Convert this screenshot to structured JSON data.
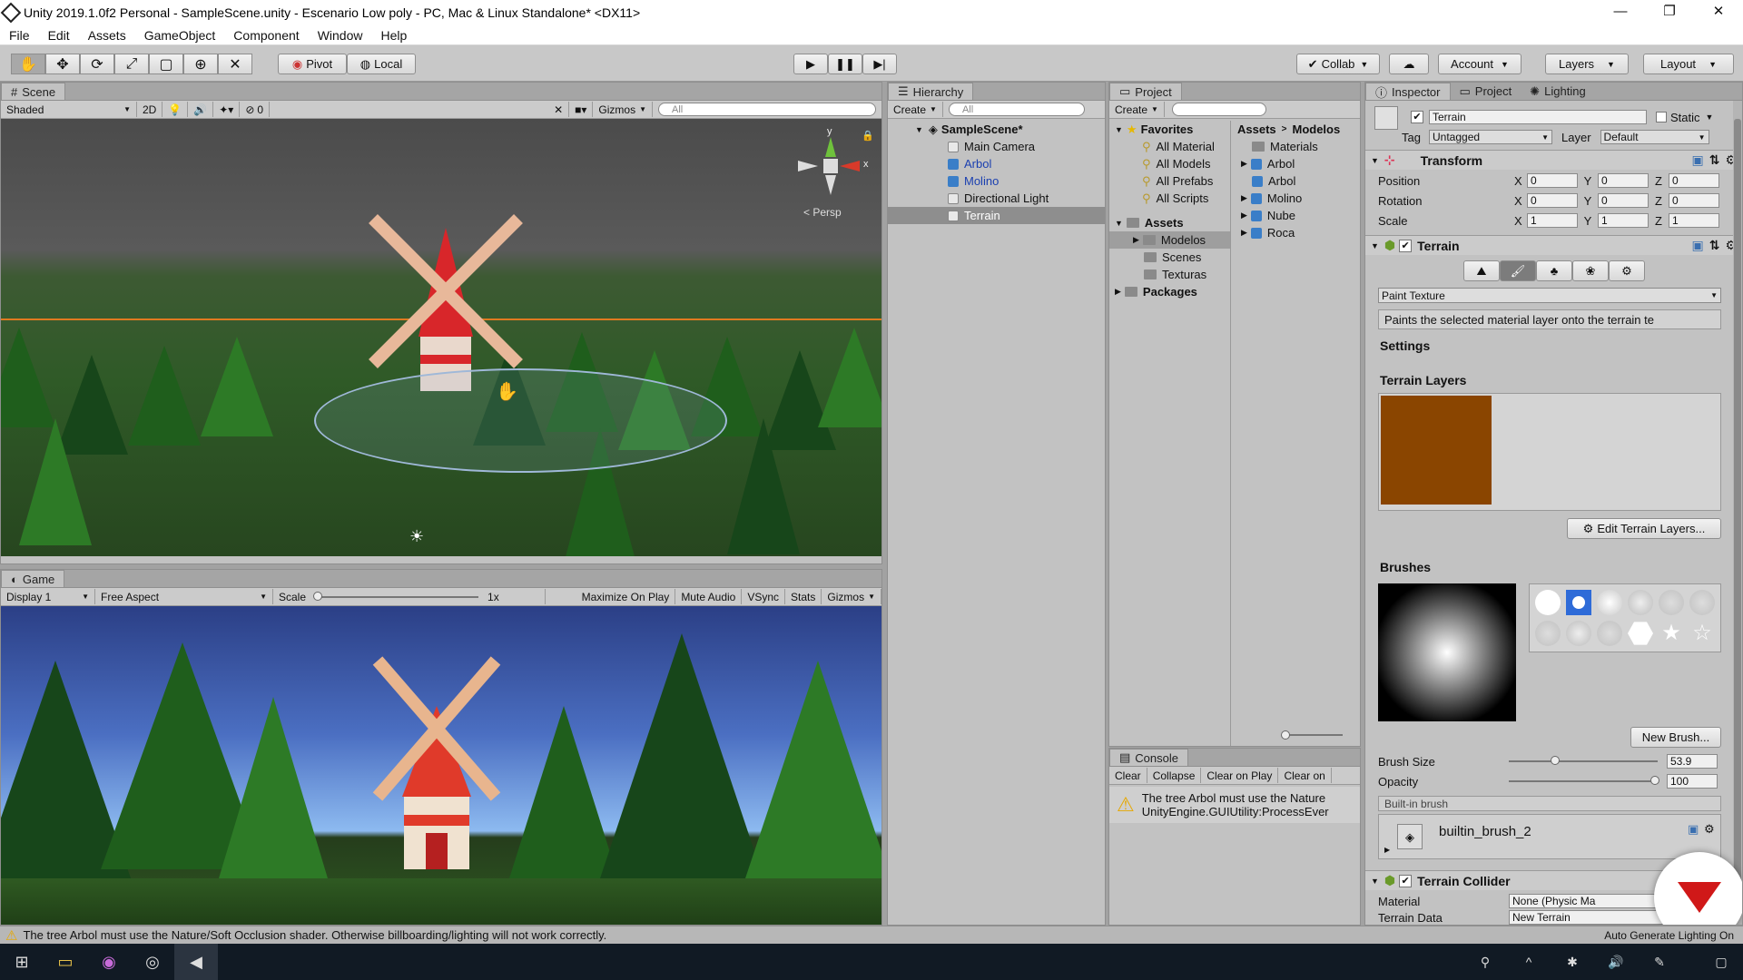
{
  "window": {
    "title": "Unity 2019.1.0f2 Personal - SampleScene.unity - Escenario Low poly - PC, Mac & Linux Standalone* <DX11>",
    "controls": [
      "—",
      "❐",
      "✕"
    ]
  },
  "menu": [
    "File",
    "Edit",
    "Assets",
    "GameObject",
    "Component",
    "Window",
    "Help"
  ],
  "toolbar": {
    "pivot_label": "Pivot",
    "local_label": "Local",
    "collab_label": "Collab",
    "account_label": "Account",
    "layers_label": "Layers",
    "layout_label": "Layout"
  },
  "scene": {
    "tab_label": "Scene",
    "shading": "Shaded",
    "mode_2d": "2D",
    "gizmos_label": "Gizmos",
    "search_placeholder": "All",
    "fx_count": "0",
    "persp_label": "Persp",
    "axis_y": "y",
    "axis_x": "x"
  },
  "game": {
    "tab_label": "Game",
    "display": "Display 1",
    "aspect": "Free Aspect",
    "scale_label": "Scale",
    "scale_value": "1x",
    "maximize_label": "Maximize On Play",
    "mute_label": "Mute Audio",
    "vsync_label": "VSync",
    "stats_label": "Stats",
    "gizmos_label": "Gizmos"
  },
  "hierarchy": {
    "tab_label": "Hierarchy",
    "create_label": "Create",
    "search_placeholder": "All",
    "scene_name": "SampleScene*",
    "items": [
      {
        "label": "Main Camera",
        "prefab": false
      },
      {
        "label": "Arbol",
        "prefab": true
      },
      {
        "label": "Molino",
        "prefab": true
      },
      {
        "label": "Directional Light",
        "prefab": false
      },
      {
        "label": "Terrain",
        "prefab": false
      }
    ]
  },
  "project": {
    "tab_label": "Project",
    "create_label": "Create",
    "favorites_label": "Favorites",
    "favorites": [
      "All Material",
      "All Models",
      "All Prefabs",
      "All Scripts"
    ],
    "assets_label": "Assets",
    "asset_folders": [
      "Modelos",
      "Scenes",
      "Texturas"
    ],
    "packages_label": "Packages",
    "breadcrumb_root": "Assets",
    "breadcrumb_current": "Modelos",
    "contents": [
      {
        "label": "Materials",
        "type": "folder"
      },
      {
        "label": "Arbol",
        "type": "model"
      },
      {
        "label": "Arbol",
        "type": "model"
      },
      {
        "label": "Molino",
        "type": "model"
      },
      {
        "label": "Nube",
        "type": "model"
      },
      {
        "label": "Roca",
        "type": "model"
      }
    ]
  },
  "console": {
    "tab_label": "Console",
    "buttons": [
      "Clear",
      "Collapse",
      "Clear on Play",
      "Clear on"
    ],
    "message_line1": "The tree Arbol must use the Nature",
    "message_line2": "UnityEngine.GUIUtility:ProcessEver"
  },
  "inspector": {
    "tabs": [
      "Inspector",
      "Project",
      "Lighting"
    ],
    "object_name": "Terrain",
    "static_label": "Static",
    "tag_label": "Tag",
    "tag_value": "Untagged",
    "layer_label": "Layer",
    "layer_value": "Default",
    "transform": {
      "title": "Transform",
      "rows": [
        {
          "label": "Position",
          "x": "0",
          "y": "0",
          "z": "0"
        },
        {
          "label": "Rotation",
          "x": "0",
          "y": "0",
          "z": "0"
        },
        {
          "label": "Scale",
          "x": "1",
          "y": "1",
          "z": "1"
        }
      ]
    },
    "terrain": {
      "title": "Terrain",
      "mode": "Paint Texture",
      "description": "Paints the selected material layer onto the terrain te",
      "settings_label": "Settings",
      "layers_label": "Terrain Layers",
      "edit_layers_label": "Edit Terrain Layers...",
      "brushes_label": "Brushes",
      "new_brush_label": "New Brush...",
      "brush_size_label": "Brush Size",
      "brush_size_value": "53.9",
      "opacity_label": "Opacity",
      "opacity_value": "100",
      "builtin_label": "Built-in brush",
      "brush_name": "builtin_brush_2",
      "layer_color": "#8a4500"
    },
    "collider": {
      "title": "Terrain Collider",
      "material_label": "Material",
      "material_value": "None (Physic Ma",
      "data_label": "Terrain Data",
      "data_value": "New Terrain"
    }
  },
  "status": {
    "message": "The tree Arbol must use the Nature/Soft Occlusion shader. Otherwise billboarding/lighting will not work correctly.",
    "right": "Auto Generate Lighting On"
  }
}
